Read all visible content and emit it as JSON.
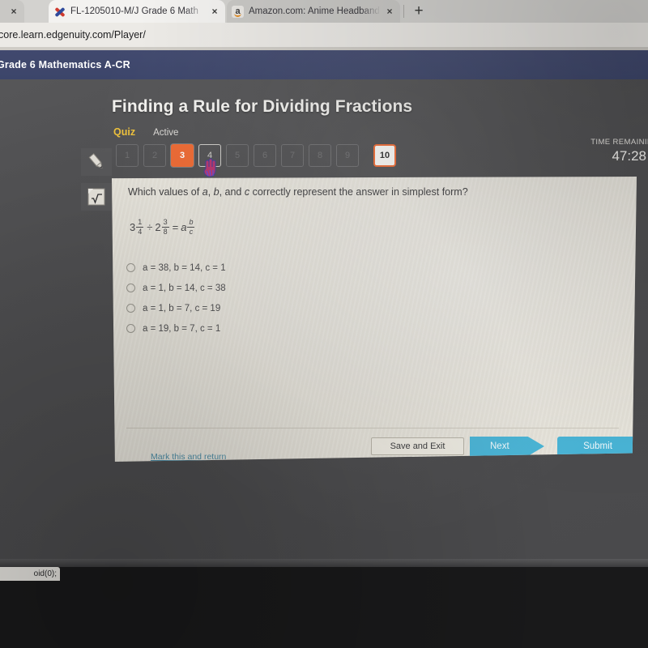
{
  "browser": {
    "tabs": [
      {
        "title": "",
        "favicon": "none",
        "close_label": "×",
        "active": false
      },
      {
        "title": "FL-1205010-M/J Grade 6 Math",
        "favicon": "x-mark-icon",
        "close_label": "×",
        "active": true
      },
      {
        "title": "Amazon.com: Anime Headband",
        "favicon": "amazon-icon",
        "close_label": "×",
        "active": false
      }
    ],
    "new_tab_label": "+",
    "url": "core.learn.edgenuity.com/Player/",
    "status_text": "oid(0);"
  },
  "header": {
    "course_name": "Grade 6 Mathematics A-CR"
  },
  "lesson": {
    "title": "Finding a Rule for Dividing Fractions",
    "type": "Quiz",
    "state": "Active"
  },
  "timer": {
    "label": "TIME REMAINING",
    "value": "47:28"
  },
  "tools": [
    {
      "name": "pencil-tool",
      "icon": "pencil-icon"
    },
    {
      "name": "calculator-tool",
      "icon": "sqrt-x-icon"
    }
  ],
  "question_nav": {
    "items": [
      {
        "label": "1",
        "state": "unvisited"
      },
      {
        "label": "2",
        "state": "unvisited"
      },
      {
        "label": "3",
        "state": "answered"
      },
      {
        "label": "4",
        "state": "current"
      },
      {
        "label": "5",
        "state": "unvisited"
      },
      {
        "label": "6",
        "state": "unvisited"
      },
      {
        "label": "7",
        "state": "unvisited"
      },
      {
        "label": "8",
        "state": "unvisited"
      },
      {
        "label": "9",
        "state": "unvisited"
      },
      {
        "label": "10",
        "state": "flagged"
      }
    ]
  },
  "question": {
    "prompt_pre": "Which values of ",
    "prompt_a": "a",
    "prompt_mid1": ", ",
    "prompt_b": "b",
    "prompt_mid2": ", and ",
    "prompt_c": "c",
    "prompt_post": " correctly represent the answer in simplest form?",
    "prompt_full": "Which values of a, b, and c correctly represent the answer in simplest form?",
    "equation": {
      "left_whole": "3",
      "left_num": "1",
      "left_den": "4",
      "operator": "÷",
      "right_whole": "2",
      "right_num": "3",
      "right_den": "8",
      "equals": "=",
      "result_whole": "a",
      "result_num": "b",
      "result_den": "c"
    },
    "options": [
      {
        "text": "a = 38, b = 14, c = 1",
        "selected": false
      },
      {
        "text": "a = 1, b = 14, c = 38",
        "selected": false
      },
      {
        "text": "a = 1, b = 7, c = 19",
        "selected": false
      },
      {
        "text": "a = 19, b = 7, c = 1",
        "selected": false
      }
    ]
  },
  "footer": {
    "mark_link": "Mark this and return",
    "save_label": "Save and Exit",
    "next_label": "Next",
    "submit_label": "Submit"
  },
  "colors": {
    "accent_orange": "#ef6a33",
    "accent_blue": "#4ab6d8",
    "header_blue": "#3c456a",
    "quiz_yellow": "#f0c33c",
    "link_blue": "#4f8fa8",
    "panel_bg": "#e9e6dd"
  }
}
